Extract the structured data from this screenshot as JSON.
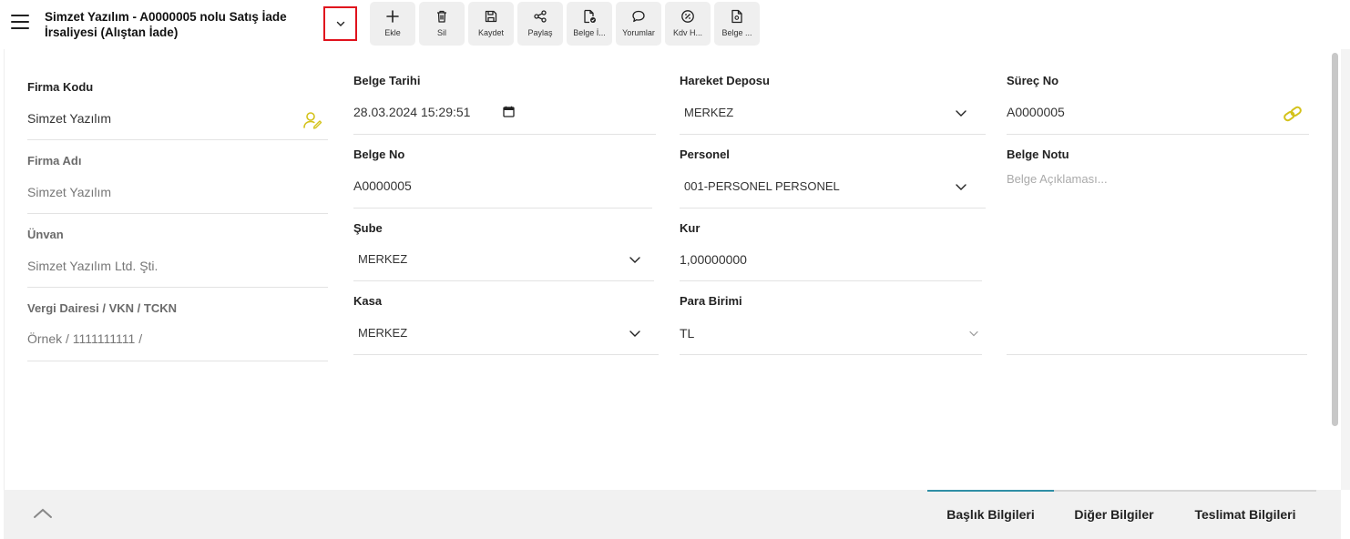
{
  "header": {
    "title": "Simzet Yazılım - A0000005 nolu Satış İade İrsaliyesi (Alıştan İade)"
  },
  "toolbar": [
    {
      "id": "add",
      "label": "Ekle",
      "icon": "plus-icon"
    },
    {
      "id": "delete",
      "label": "Sil",
      "icon": "trash-icon"
    },
    {
      "id": "save",
      "label": "Kaydet",
      "icon": "save-icon"
    },
    {
      "id": "share",
      "label": "Paylaş",
      "icon": "share-icon"
    },
    {
      "id": "doc",
      "label": "Belge İ...",
      "icon": "document-check-icon"
    },
    {
      "id": "comments",
      "label": "Yorumlar",
      "icon": "comment-icon"
    },
    {
      "id": "vat",
      "label": "Kdv H...",
      "icon": "percent-icon"
    },
    {
      "id": "doc2",
      "label": "Belge ...",
      "icon": "document-icon"
    }
  ],
  "col1": {
    "firma_kodu_label": "Firma Kodu",
    "firma_kodu_value": "Simzet Yazılım",
    "firma_adi_label": "Firma Adı",
    "firma_adi_value": "Simzet Yazılım",
    "unvan_label": "Ünvan",
    "unvan_value": "Simzet Yazılım Ltd. Şti.",
    "vergi_label": "Vergi Dairesi / VKN / TCKN",
    "vergi_value": "Örnek / 1111111111 /"
  },
  "col2": {
    "belge_tarihi_label": "Belge Tarihi",
    "belge_tarihi_value": "28.03.2024 15:29:51",
    "belge_no_label": "Belge No",
    "belge_no_value": "A0000005",
    "sube_label": "Şube",
    "sube_value": "MERKEZ",
    "kasa_label": "Kasa",
    "kasa_value": "MERKEZ"
  },
  "col3": {
    "hareket_deposu_label": "Hareket Deposu",
    "hareket_deposu_value": "MERKEZ",
    "personel_label": "Personel",
    "personel_value": "001-PERSONEL PERSONEL",
    "kur_label": "Kur",
    "kur_value": "1,00000000",
    "para_birimi_label": "Para Birimi",
    "para_birimi_value": "TL"
  },
  "col4": {
    "surec_no_label": "Süreç No",
    "surec_no_value": "A0000005",
    "belge_notu_label": "Belge Notu",
    "belge_notu_placeholder": "Belge Açıklaması..."
  },
  "footer": {
    "tabs": [
      {
        "label": "Başlık Bilgileri",
        "active": true
      },
      {
        "label": "Diğer Bilgiler",
        "active": false
      },
      {
        "label": "Teslimat Bilgileri",
        "active": false
      }
    ]
  },
  "colors": {
    "accent": "#d4c21a",
    "active_tab": "#2f8fa6",
    "highlight_border": "#e0121d"
  }
}
